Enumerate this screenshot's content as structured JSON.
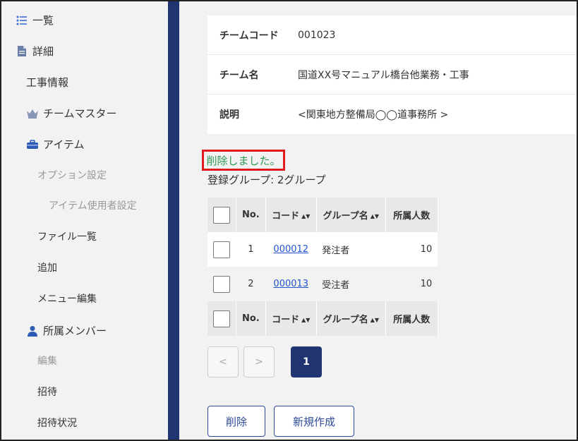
{
  "sidebar": {
    "items": [
      {
        "label": "一覧",
        "icon": "list-icon"
      },
      {
        "label": "詳細",
        "icon": "document-icon"
      },
      {
        "label": "工事情報"
      },
      {
        "label": "チームマスター",
        "icon": "crown-icon"
      },
      {
        "label": "アイテム",
        "icon": "toolbox-icon"
      },
      {
        "label": "オプション設定"
      },
      {
        "label": "アイテム使用者設定"
      },
      {
        "label": "ファイル一覧"
      },
      {
        "label": "追加"
      },
      {
        "label": "メニュー編集"
      },
      {
        "label": "所属メンバー",
        "icon": "person-icon"
      },
      {
        "label": "編集"
      },
      {
        "label": "招待"
      },
      {
        "label": "招待状況"
      }
    ]
  },
  "team_info": {
    "code_label": "チームコード",
    "code_value": "001023",
    "name_label": "チーム名",
    "name_value": "国道XX号マニュアル橋台他業務・工事",
    "desc_label": "説明",
    "desc_value": "<関東地方整備局◯◯道事務所 >"
  },
  "notice": "削除しました。",
  "group_count": "登録グループ: 2グループ",
  "table": {
    "headers": {
      "no": "No.",
      "code": "コード",
      "group": "グループ名",
      "count": "所属人数"
    },
    "rows": [
      {
        "no": "1",
        "code": "000012",
        "group": "発注者",
        "count": "10"
      },
      {
        "no": "2",
        "code": "000013",
        "group": "受注者",
        "count": "10"
      }
    ]
  },
  "pager": {
    "prev": "<",
    "next": ">",
    "current": "1"
  },
  "actions": {
    "delete": "削除",
    "create": "新規作成"
  },
  "colors": {
    "accent": "#1f3470",
    "notice_text": "#2e9a52",
    "notice_border": "#e01b1b",
    "link": "#2255cc"
  }
}
